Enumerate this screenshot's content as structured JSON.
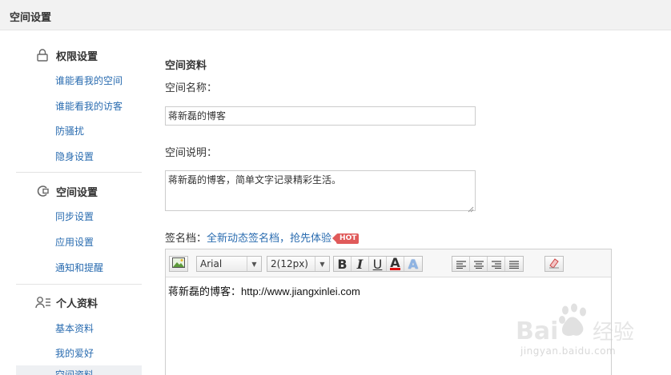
{
  "header": {
    "title": "空间设置"
  },
  "sidebar": {
    "sections": [
      {
        "title": "权限设置",
        "icon": "lock-icon",
        "items": [
          "谁能看我的空间",
          "谁能看我的访客",
          "防骚扰",
          "隐身设置"
        ]
      },
      {
        "title": "空间设置",
        "icon": "sync-icon",
        "items": [
          "同步设置",
          "应用设置",
          "通知和提醒"
        ]
      },
      {
        "title": "个人资料",
        "icon": "profile-icon",
        "items": [
          "基本资料",
          "我的爱好",
          "空间资料"
        ]
      }
    ]
  },
  "main": {
    "section_title": "空间资料",
    "name_label": "空间名称：",
    "name_value": "蒋新磊的博客",
    "desc_label": "空间说明：",
    "desc_value": "蒋新磊的博客，简单文字记录精彩生活。",
    "signature_label": "签名档：",
    "signature_promo": "全新动态签名档，抢先体验",
    "hot_badge": "HOT"
  },
  "editor": {
    "font_family": "Arial",
    "font_size": "2(12px)",
    "content": "蒋新磊的博客：http://www.jiangxinlei.com",
    "toolbar_icons": [
      "image-icon",
      "bold-icon",
      "italic-icon",
      "underline-icon",
      "font-color-icon",
      "highlight-icon",
      "align-left-icon",
      "align-center-icon",
      "align-right-icon",
      "align-justify-icon",
      "eraser-icon"
    ],
    "bold": "B",
    "italic": "I",
    "underline": "U",
    "font_color_letter": "A",
    "highlight_letter": "A"
  },
  "watermark": {
    "logo_text": "Bai经验",
    "url": "jingyan.baidu.com"
  },
  "colors": {
    "link": "#2a6cb0",
    "hot": "#e05a5a",
    "header_bg": "#f2f2f2"
  }
}
